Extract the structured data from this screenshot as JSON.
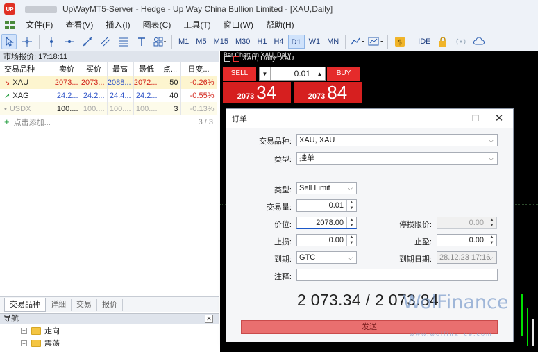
{
  "window": {
    "title": "UpWayMT5-Server - Hedge - Up Way China Bullion Limited - [XAU,Daily]",
    "logo_text": "UP"
  },
  "menu": [
    "文件(F)",
    "查看(V)",
    "插入(I)",
    "图表(C)",
    "工具(T)",
    "窗口(W)",
    "帮助(H)"
  ],
  "toolbar": {
    "timeframes": [
      "M1",
      "M5",
      "M15",
      "M30",
      "H1",
      "H4",
      "D1",
      "W1",
      "MN"
    ],
    "active_timeframe": "D1",
    "ide_label": "IDE"
  },
  "market_watch": {
    "header": "市场报价: 17:18:11",
    "columns": [
      "交易品种",
      "卖价",
      "买价",
      "最高",
      "最低",
      "点...",
      "日变..."
    ],
    "rows": [
      {
        "symbol": "XAU",
        "bid": "2073...",
        "ask": "2073...",
        "high": "2088...",
        "low": "2072...",
        "spread": "50",
        "change": "-0.26%"
      },
      {
        "symbol": "XAG",
        "bid": "24.2...",
        "ask": "24.2...",
        "high": "24.4...",
        "low": "24.2...",
        "spread": "40",
        "change": "-0.55%"
      },
      {
        "symbol": "USDX",
        "bid": "100....",
        "ask": "100....",
        "high": "100....",
        "low": "100....",
        "spread": "3",
        "change": "-0.13%"
      }
    ],
    "add_label": "点击添加...",
    "count": "3 / 3",
    "tabs": [
      "交易品种",
      "详细",
      "交易",
      "报价"
    ]
  },
  "navigator": {
    "header": "导航",
    "items": [
      "走向",
      "震荡"
    ]
  },
  "chart": {
    "tab_text": "Bar Chart on XAU, Daily",
    "header": "XAU, Daily: XAU",
    "one_click": {
      "sell_label": "SELL",
      "buy_label": "BUY",
      "lot": "0.01",
      "sell_small": "2073",
      "sell_big": "34",
      "buy_small": "2073",
      "buy_big": "84"
    }
  },
  "order_dialog": {
    "title": "订单",
    "symbol_label": "交易品种:",
    "symbol_value": "XAU, XAU",
    "type_label": "类型:",
    "type_value": "挂单",
    "order_type_label": "类型:",
    "order_type_value": "Sell Limit",
    "volume_label": "交易量:",
    "volume_value": "0.01",
    "price_label": "价位:",
    "price_value": "2078.00",
    "stop_limit_label": "停损限价:",
    "stop_limit_value": "0.00",
    "sl_label": "止损:",
    "sl_value": "0.00",
    "tp_label": "止盈:",
    "tp_value": "0.00",
    "expiry_label": "到期:",
    "expiry_value": "GTC",
    "expiry_date_label": "到期日期:",
    "expiry_date_value": "28.12.23 17:16",
    "comment_label": "注释:",
    "comment_value": "",
    "prices": "2 073.34 / 2 073.84",
    "send_label": "发送"
  },
  "watermark": {
    "brand": "WolFinance",
    "url": "www.wolfinance.com"
  }
}
